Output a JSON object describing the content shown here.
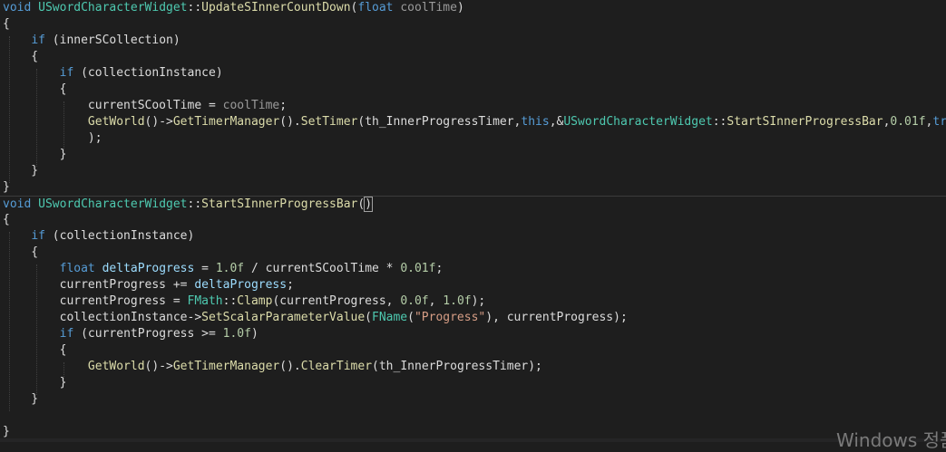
{
  "editor": {
    "lines": [
      {
        "tokens": [
          [
            "void",
            "kw"
          ],
          [
            " ",
            ""
          ],
          [
            "USwordCharacterWidget",
            "type"
          ],
          [
            "::",
            ""
          ],
          [
            "UpdateSInnerCountDown",
            "func"
          ],
          [
            "(",
            ""
          ],
          [
            "float",
            "kw"
          ],
          [
            " ",
            ""
          ],
          [
            "coolTime",
            "param"
          ],
          [
            ")",
            ""
          ]
        ]
      },
      {
        "tokens": [
          [
            "{",
            ""
          ]
        ]
      },
      {
        "tokens": [
          [
            "    ",
            ""
          ],
          [
            "if",
            "kw"
          ],
          [
            " (innerSCollection)",
            ""
          ]
        ]
      },
      {
        "tokens": [
          [
            "    {",
            ""
          ]
        ]
      },
      {
        "tokens": [
          [
            "        ",
            ""
          ],
          [
            "if",
            "kw"
          ],
          [
            " (collectionInstance)",
            ""
          ]
        ]
      },
      {
        "tokens": [
          [
            "        {",
            ""
          ]
        ]
      },
      {
        "tokens": [
          [
            "            currentSCoolTime = ",
            ""
          ],
          [
            "coolTime",
            "param"
          ],
          [
            ";",
            ""
          ]
        ]
      },
      {
        "tokens": [
          [
            "            ",
            ""
          ],
          [
            "GetWorld",
            "func"
          ],
          [
            "()->",
            ""
          ],
          [
            "GetTimerManager",
            "func"
          ],
          [
            "().",
            ""
          ],
          [
            "SetTimer",
            "func"
          ],
          [
            "(th_InnerProgressTimer,",
            ""
          ],
          [
            "this",
            "kw"
          ],
          [
            ",&",
            ""
          ],
          [
            "USwordCharacterWidget",
            "type"
          ],
          [
            "::",
            ""
          ],
          [
            "StartSInnerProgressBar",
            "func"
          ],
          [
            ",",
            ""
          ],
          [
            "0.01f",
            "num"
          ],
          [
            ",",
            ""
          ],
          [
            "true",
            "kw"
          ]
        ]
      },
      {
        "tokens": [
          [
            "            );",
            ""
          ]
        ]
      },
      {
        "tokens": [
          [
            "        }",
            ""
          ]
        ]
      },
      {
        "tokens": [
          [
            "    }",
            ""
          ]
        ]
      },
      {
        "tokens": [
          [
            "}",
            ""
          ]
        ]
      },
      {
        "sep": true,
        "tokens": [
          [
            "void",
            "kw"
          ],
          [
            " ",
            ""
          ],
          [
            "USwordCharacterWidget",
            "type"
          ],
          [
            "::",
            ""
          ],
          [
            "StartSInnerProgressBar",
            "func"
          ],
          [
            "(",
            ""
          ],
          [
            ")",
            "caret"
          ]
        ]
      },
      {
        "tokens": [
          [
            "{",
            ""
          ]
        ]
      },
      {
        "tokens": [
          [
            "    ",
            ""
          ],
          [
            "if",
            "kw"
          ],
          [
            " (collectionInstance)",
            ""
          ]
        ]
      },
      {
        "tokens": [
          [
            "    {",
            ""
          ]
        ]
      },
      {
        "tokens": [
          [
            "        ",
            ""
          ],
          [
            "float",
            "kw"
          ],
          [
            " ",
            ""
          ],
          [
            "deltaProgress",
            "local"
          ],
          [
            " = ",
            ""
          ],
          [
            "1.0f",
            "num"
          ],
          [
            " / currentSCoolTime * ",
            ""
          ],
          [
            "0.01f",
            "num"
          ],
          [
            ";",
            ""
          ]
        ]
      },
      {
        "tokens": [
          [
            "        currentProgress += ",
            ""
          ],
          [
            "deltaProgress",
            "local"
          ],
          [
            ";",
            ""
          ]
        ]
      },
      {
        "tokens": [
          [
            "        currentProgress = ",
            ""
          ],
          [
            "FMath",
            "type"
          ],
          [
            "::",
            ""
          ],
          [
            "Clamp",
            "func"
          ],
          [
            "(currentProgress, ",
            ""
          ],
          [
            "0.0f",
            "num"
          ],
          [
            ", ",
            ""
          ],
          [
            "1.0f",
            "num"
          ],
          [
            ");",
            ""
          ]
        ]
      },
      {
        "tokens": [
          [
            "        collectionInstance->",
            ""
          ],
          [
            "SetScalarParameterValue",
            "func"
          ],
          [
            "(",
            ""
          ],
          [
            "FName",
            "type"
          ],
          [
            "(",
            ""
          ],
          [
            "\"Progress\"",
            "str"
          ],
          [
            "), currentProgress);",
            ""
          ]
        ]
      },
      {
        "tokens": [
          [
            "        ",
            ""
          ],
          [
            "if",
            "kw"
          ],
          [
            " (currentProgress >= ",
            ""
          ],
          [
            "1.0f",
            "num"
          ],
          [
            ")",
            ""
          ]
        ]
      },
      {
        "tokens": [
          [
            "        {",
            ""
          ]
        ]
      },
      {
        "tokens": [
          [
            "            ",
            ""
          ],
          [
            "GetWorld",
            "func"
          ],
          [
            "()->",
            ""
          ],
          [
            "GetTimerManager",
            "func"
          ],
          [
            "().",
            ""
          ],
          [
            "ClearTimer",
            "func"
          ],
          [
            "(th_InnerProgressTimer);",
            ""
          ]
        ]
      },
      {
        "tokens": [
          [
            "        }",
            ""
          ]
        ]
      },
      {
        "tokens": [
          [
            "    }",
            ""
          ]
        ]
      },
      {
        "tokens": [
          [
            "",
            ""
          ]
        ]
      },
      {
        "tokens": [
          [
            "}",
            ""
          ]
        ]
      }
    ]
  },
  "watermark": "Windows 정품"
}
